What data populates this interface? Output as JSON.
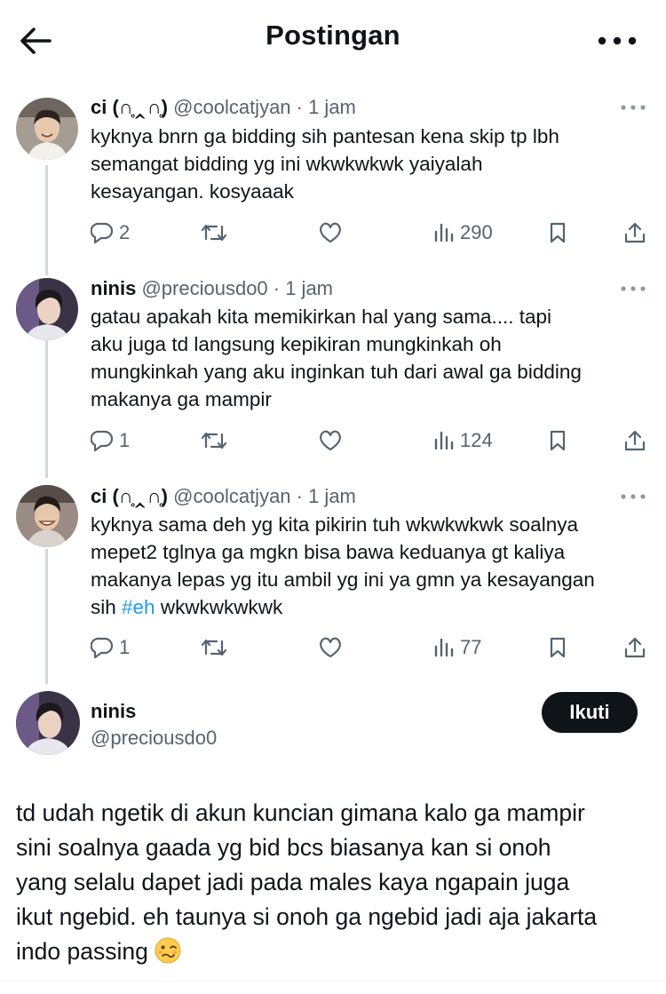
{
  "header": {
    "title": "Postingan",
    "back_icon": "arrow-left-icon",
    "more_icon": "more-horizontal-icon"
  },
  "replies": [
    {
      "name": "ci (∩̥‸∩̥)",
      "meta": "@coolcatjyan · 1 jam",
      "text_lines": [
        "kyknya bnrn ga bidding sih pantesan kena skip tp lbh",
        "semangat bidding yg ini wkwkwkwk yaiyalah",
        "kesayangan. kosyaaak"
      ],
      "reply_count": "2",
      "views": "290"
    },
    {
      "name": "ninis",
      "meta": "@preciousdo0 · 1 jam",
      "text_lines": [
        "gatau apakah kita memikirkan hal yang sama.... tapi",
        "aku juga td langsung kepikiran mungkinkah oh",
        "mungkinkah yang aku inginkan tuh dari awal ga bidding",
        "makanya ga mampir"
      ],
      "reply_count": "1",
      "views": "124"
    },
    {
      "name": "ci (∩̥‸∩̥)",
      "meta": "@coolcatjyan · 1 jam",
      "text_lines": [
        "kyknya sama deh yg kita pikirin tuh wkwkwkwk soalnya",
        "mepet2 tglnya ga mgkn bisa bawa keduanya gt kaliya",
        "makanya lepas yg itu ambil yg ini ya gmn ya kesayangan"
      ],
      "text_last_prefix": "sih ",
      "hashtag": "#eh",
      "text_last_suffix": " wkwkwkwkwk",
      "reply_count": "1",
      "views": "77"
    }
  ],
  "main_post": {
    "name": "ninis",
    "handle": "@preciousdo0",
    "follow_label": "Ikuti",
    "text_lines": [
      "td udah ngetik di akun kuncian gimana kalo ga mampir",
      "sini soalnya gaada yg bid bcs biasanya kan si onoh",
      "yang selalu dapet jadi pada males kaya ngapain juga",
      "ikut ngebid. eh taunya si onoh ga ngebid jadi aja jakarta"
    ],
    "last_line": "indo passing",
    "emoji": "woozy-face-emoji"
  },
  "icons": {
    "reply": "reply-bubble-icon",
    "retweet": "retweet-icon",
    "like": "heart-icon",
    "views": "views-bar-chart-icon",
    "bookmark": "bookmark-icon",
    "share": "share-upload-icon"
  },
  "colors": {
    "text": "#0f1419",
    "secondary": "#536471",
    "link": "#1d9bf0",
    "thread_line": "#cfd9de"
  }
}
